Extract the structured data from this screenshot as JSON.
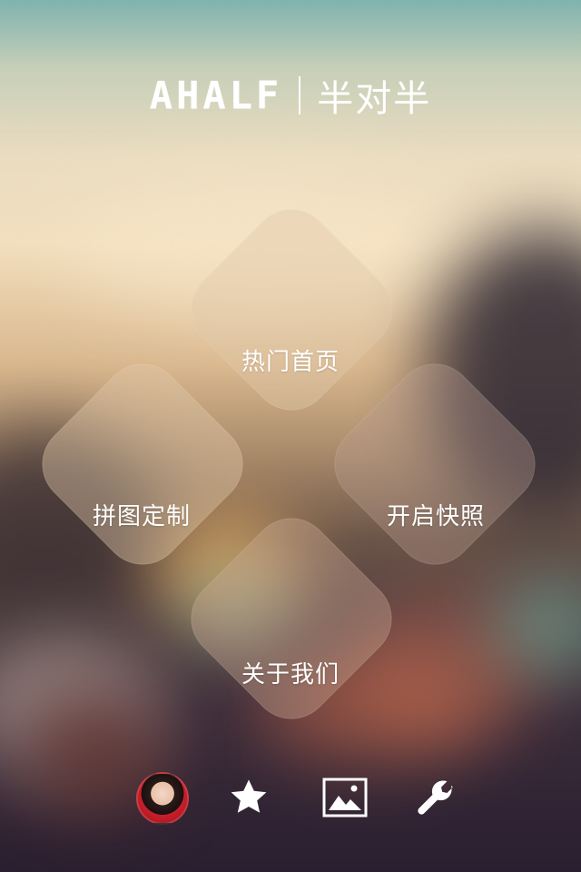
{
  "header": {
    "logo_en": "AHALF",
    "logo_cn": "半对半"
  },
  "menu": {
    "top": "热门首页",
    "left": "拼图定制",
    "right": "开启快照",
    "bottom": "关于我们"
  },
  "tabbar": {
    "items": [
      "avatar",
      "star-icon",
      "image-icon",
      "wrench-icon"
    ]
  },
  "colors": {
    "text": "#ffffff"
  }
}
